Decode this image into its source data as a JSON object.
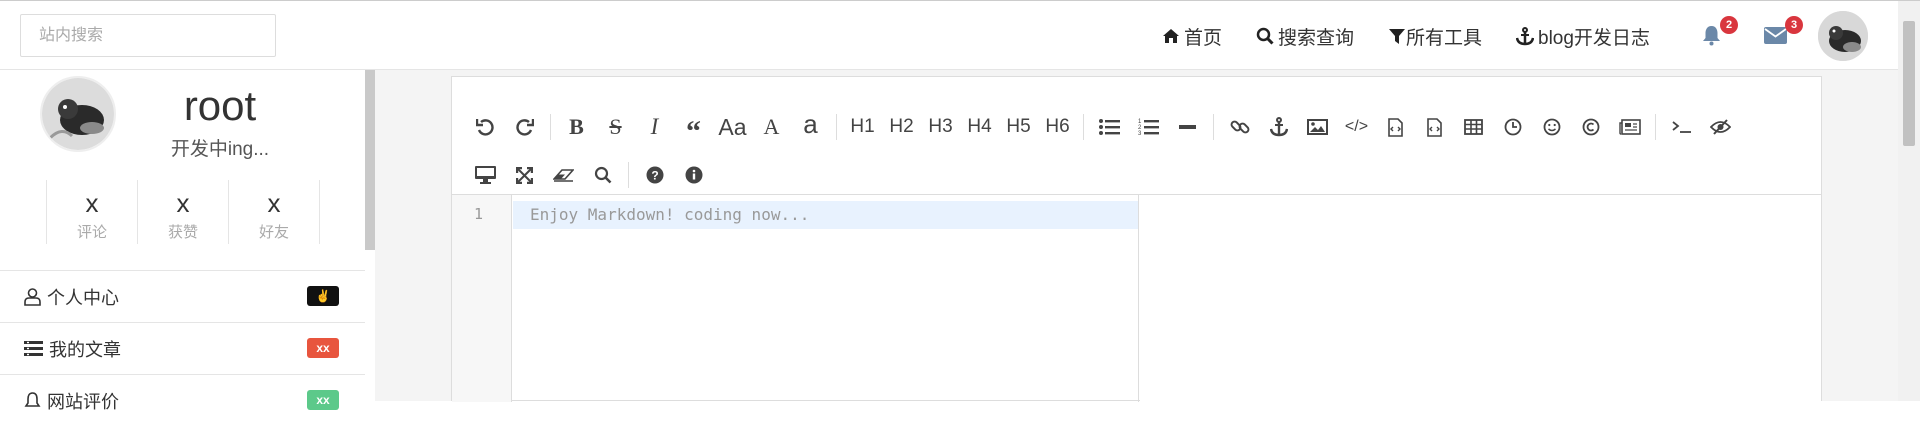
{
  "header": {
    "search_placeholder": "站内搜索",
    "nav": [
      {
        "label": "首页",
        "icon": "home-icon"
      },
      {
        "label": "搜索查询",
        "icon": "search-icon"
      },
      {
        "label": "所有工具",
        "icon": "filter-icon"
      },
      {
        "label": "blog开发日志",
        "icon": "anchor-icon"
      }
    ],
    "notifications_count": "2",
    "messages_count": "3"
  },
  "sidebar": {
    "username": "root",
    "motto": "开发中ing...",
    "stats": [
      {
        "value": "x",
        "label": "评论"
      },
      {
        "value": "x",
        "label": "获赞"
      },
      {
        "value": "x",
        "label": "好友"
      }
    ],
    "menu": [
      {
        "label": "个人中心",
        "tag": "✌",
        "tag_color": "#111111",
        "icon": "user-icon"
      },
      {
        "label": "我的文章",
        "tag": "xx",
        "tag_color": "#e8553e",
        "icon": "list-icon"
      },
      {
        "label": "网站评价",
        "tag": "xx",
        "tag_color": "#5cc98a",
        "icon": "bell-icon"
      }
    ]
  },
  "editor": {
    "headings": [
      "H1",
      "H2",
      "H3",
      "H4",
      "H5",
      "H6"
    ],
    "case_buttons": [
      "Aa",
      "A",
      "a"
    ],
    "line_number": "1",
    "placeholder": "Enjoy Markdown! coding now..."
  }
}
